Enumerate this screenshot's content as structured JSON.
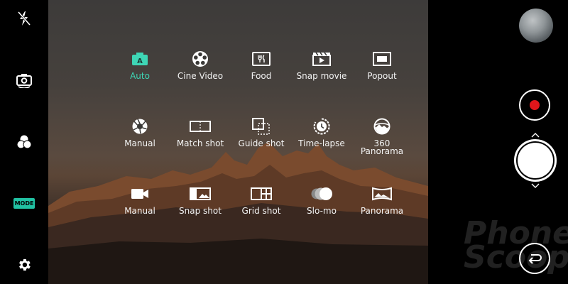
{
  "left_toolbar": {
    "items": [
      {
        "name": "flash-off-icon"
      },
      {
        "name": "switch-camera-icon"
      },
      {
        "name": "filter-icon"
      },
      {
        "name": "mode-button",
        "label": "MODE"
      },
      {
        "name": "settings-icon"
      }
    ],
    "accent": "#21c2a3"
  },
  "modes": [
    {
      "label": "Auto",
      "icon": "auto-icon",
      "active": true
    },
    {
      "label": "Cine Video",
      "icon": "film-reel-icon"
    },
    {
      "label": "Food",
      "icon": "food-icon"
    },
    {
      "label": "Snap movie",
      "icon": "snap-movie-icon"
    },
    {
      "label": "Popout",
      "icon": "popout-icon"
    },
    {
      "label": "Manual",
      "icon": "aperture-icon"
    },
    {
      "label": "Match shot",
      "icon": "match-shot-icon"
    },
    {
      "label": "Guide shot",
      "icon": "guide-shot-icon"
    },
    {
      "label": "Time-lapse",
      "icon": "timelapse-icon"
    },
    {
      "label": "360\nPanorama",
      "icon": "panorama-360-icon"
    },
    {
      "label": "Manual",
      "icon": "video-camera-icon"
    },
    {
      "label": "Snap shot",
      "icon": "snap-shot-icon"
    },
    {
      "label": "Grid shot",
      "icon": "grid-shot-icon"
    },
    {
      "label": "Slo-mo",
      "icon": "slo-mo-icon"
    },
    {
      "label": "Panorama",
      "icon": "panorama-icon"
    }
  ],
  "right_controls": {
    "thumbnail": "gallery-thumbnail",
    "record_color": "#e0161b",
    "watermark": "Phone\nScoop"
  }
}
